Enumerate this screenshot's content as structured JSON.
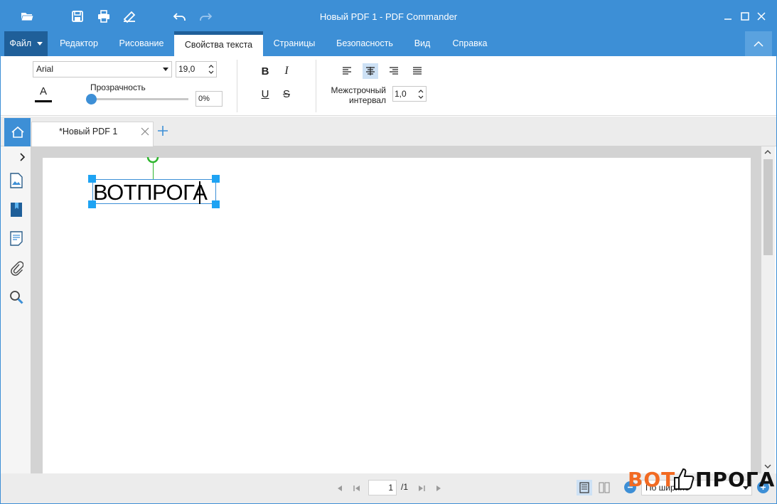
{
  "window": {
    "title": "Новый PDF 1 - PDF Commander"
  },
  "menu": {
    "file": "Файл",
    "tabs": [
      "Редактор",
      "Рисование",
      "Свойства текста",
      "Страницы",
      "Безопасность",
      "Вид",
      "Справка"
    ],
    "active_tab": "Свойства текста"
  },
  "ribbon": {
    "font_family": "Arial",
    "font_size": "19,0",
    "color_letter": "A",
    "opacity_label": "Прозрачность",
    "opacity_value": "0%",
    "opacity_fraction": 0,
    "bold": "B",
    "italic": "I",
    "underline": "U",
    "strike": "S",
    "active_alignment": "center",
    "line_spacing_label_1": "Межстрочный",
    "line_spacing_label_2": "интервал",
    "line_spacing_value": "1,0"
  },
  "document_tabs": {
    "tab_label": "*Новый PDF 1"
  },
  "canvas": {
    "text_content": "ВОТПРОГА"
  },
  "statusbar": {
    "current_page": "1",
    "total_pages": "/1",
    "zoom_mode": "По ширине"
  },
  "watermark": {
    "text_left": "ВОТ",
    "text_right": "ПРОГА"
  },
  "colors": {
    "accent": "#3d8fd6",
    "accent_dark": "#1f5f99",
    "handle": "#1ea3f3",
    "rotation": "#2db52d",
    "watermark_orange": "#f26a22"
  }
}
